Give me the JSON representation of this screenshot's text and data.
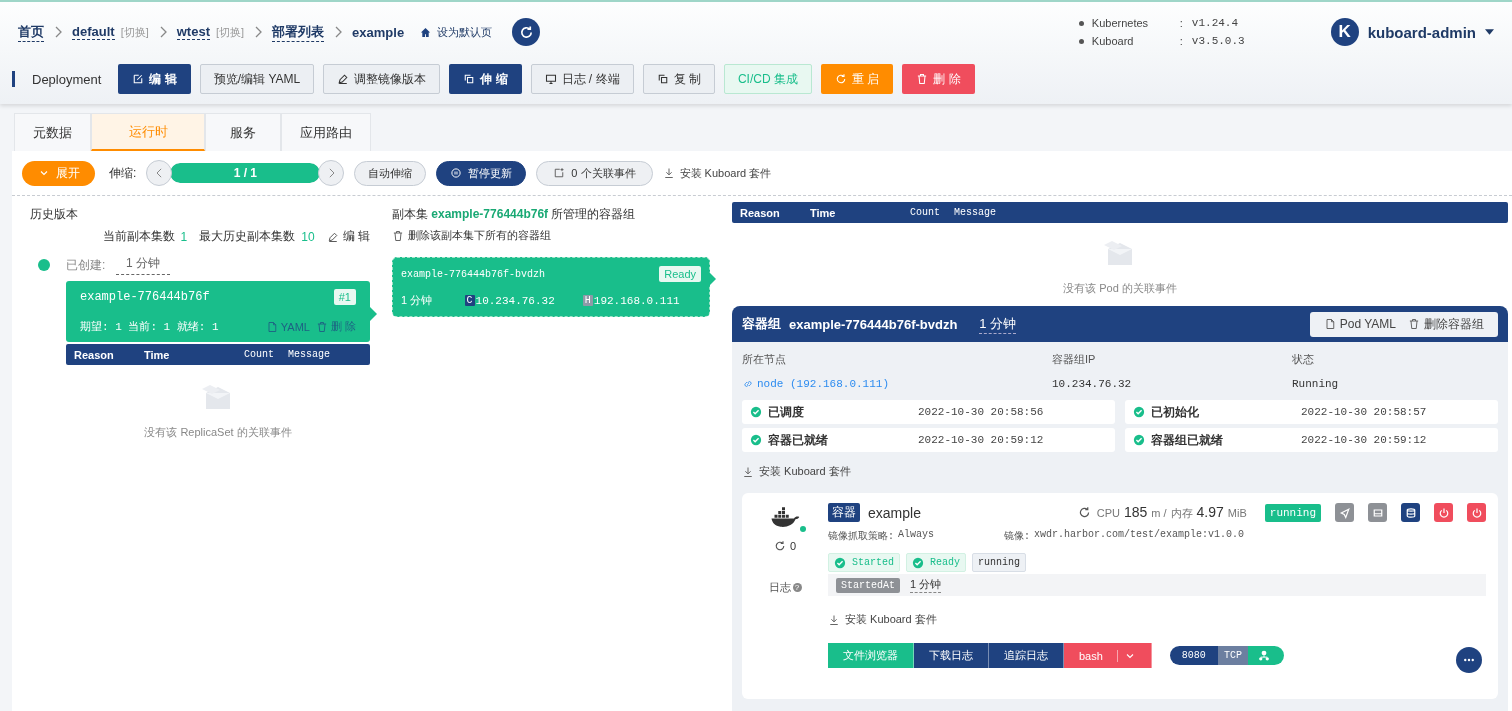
{
  "breadcrumb": {
    "items": [
      {
        "label": "首页"
      },
      {
        "label": "default",
        "switch": "[切换]"
      },
      {
        "label": "wtest",
        "switch": "[切换]"
      },
      {
        "label": "部署列表"
      }
    ],
    "current": "example",
    "set_default": "设为默认页"
  },
  "versions": [
    {
      "name": "Kubernetes",
      "sep": ":",
      "value": "v1.24.4"
    },
    {
      "name": "Kuboard",
      "sep": ":",
      "value": "v3.5.0.3"
    }
  ],
  "user": {
    "initial": "K",
    "name": "kuboard-admin"
  },
  "toolbar": {
    "kind_label": "Deployment",
    "buttons": [
      {
        "label": "编 辑"
      },
      {
        "label": "预览/编辑 YAML"
      },
      {
        "label": "调整镜像版本"
      },
      {
        "label": "伸 缩"
      },
      {
        "label": "日志 / 终端"
      },
      {
        "label": "复 制"
      },
      {
        "label": "CI/CD 集成"
      },
      {
        "label": "重 启"
      },
      {
        "label": "删 除"
      }
    ]
  },
  "tabs": [
    {
      "label": "元数据",
      "selected": false
    },
    {
      "label": "运行时",
      "selected": true
    },
    {
      "label": "服务",
      "selected": false
    },
    {
      "label": "应用路由",
      "selected": false
    }
  ],
  "controls": {
    "expand": "展开",
    "scale_label": "伸缩:",
    "scale_value": "1 / 1",
    "level": 1,
    "auto_scale": "自动伸缩",
    "pause": "暂停更新",
    "events": "0 个关联事件",
    "install": "安装 Kuboard 套件"
  },
  "history": {
    "title": "历史版本",
    "current_label": "当前副本集数",
    "current": "1",
    "max_label": "最大历史副本集数",
    "max": "10",
    "edit": "编 辑",
    "created_label": "已创建:",
    "created": "1 分钟",
    "replicaset": {
      "name": "example-776444b76f",
      "revision": "#1",
      "stats": "期望: 1 当前: 1 就绪: 1",
      "yaml": "YAML",
      "delete": "删 除"
    },
    "event_columns": [
      "Reason",
      "Time",
      "Count",
      "Message"
    ],
    "empty": "没有该 ReplicaSet 的关联事件"
  },
  "replicaset_pods": {
    "title": "副本集 **example-776444b76f** 所管理的容器组",
    "delete_all": "删除该副本集下所有的容器组",
    "pod": {
      "name": "example-776444b76f-bvdzh",
      "status": "Ready",
      "age": "1 分钟",
      "c_mark": "C",
      "cluster_ip": "10.234.76.32",
      "h_mark": "H",
      "host_ip": "192.168.0.111"
    }
  },
  "pod_events": {
    "columns": [
      "Reason",
      "Time",
      "Count",
      "Message"
    ],
    "empty": "没有该 Pod 的关联事件"
  },
  "pod": {
    "title_label": "容器组",
    "name": "example-776444b76f-bvdzh",
    "age": "1 分钟",
    "yaml": "Pod YAML",
    "delete": "删除容器组",
    "fields": [
      {
        "label": "所在节点",
        "value": "node (192.168.0.111)",
        "kind": "link"
      },
      {
        "label": "容器组IP",
        "value": "10.234.76.32",
        "kind": "text"
      },
      {
        "label": "状态",
        "value": "Running",
        "kind": "text"
      }
    ],
    "conditions": [
      {
        "label": "已调度",
        "time": "2022-10-30 20:58:56",
        "ok": true
      },
      {
        "label": "已初始化",
        "time": "2022-10-30 20:58:57",
        "ok": true
      },
      {
        "label": "容器已就绪",
        "time": "2022-10-30 20:59:12",
        "ok": true
      },
      {
        "label": "容器组已就绪",
        "time": "2022-10-30 20:59:12",
        "ok": true
      }
    ],
    "install": "安装 Kuboard 套件"
  },
  "container": {
    "badge": "容器",
    "name": "example",
    "ready": true,
    "restarts": "0",
    "log_label": "日志",
    "help_mark": "?",
    "metrics": [
      {
        "label": "CPU",
        "value": "185",
        "unit": "m /"
      },
      {
        "label": "内存",
        "value": "4.97",
        "unit": "MiB"
      }
    ],
    "state": "running",
    "actions": [
      {
        "color": "#8e9196"
      },
      {
        "color": "#8e9196"
      },
      {
        "color": "#1f4280"
      },
      {
        "color": "#f04d5d"
      },
      {
        "color": "#f04d5d"
      }
    ],
    "pull_policy_label": "镜像抓取策略:",
    "pull_policy": "Always",
    "image_label": "镜像:",
    "image": "xwdr.harbor.com/test/example:v1.0.0",
    "tags": [
      {
        "label": "Started",
        "kind": "check"
      },
      {
        "label": "Ready",
        "kind": "check"
      },
      {
        "label": "running",
        "kind": "plain"
      }
    ],
    "started_at_label": "StartedAt",
    "started_at": "1 分钟",
    "install": "安装 Kuboard 套件",
    "buttons": [
      {
        "label": "文件浏览器",
        "color": "#19be8b"
      },
      {
        "label": "下载日志",
        "color": "#1f4280"
      },
      {
        "label": "追踪日志",
        "color": "#1f4280"
      },
      {
        "label": "bash",
        "color": "#f04d5d",
        "dropdown": true
      }
    ],
    "port": {
      "number": "8080",
      "protocol": "TCP"
    }
  }
}
